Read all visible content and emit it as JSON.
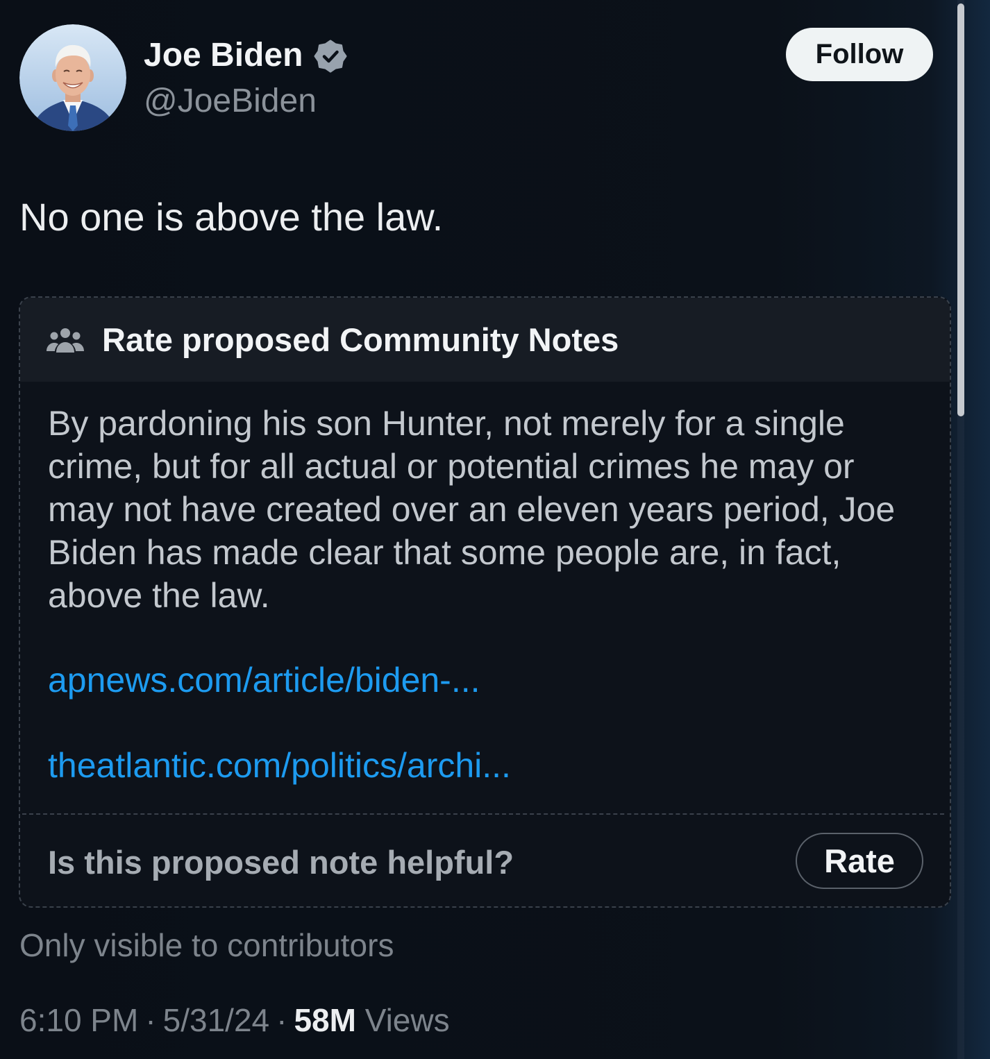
{
  "tweet": {
    "author": {
      "name": "Joe Biden",
      "handle": "@JoeBiden",
      "badge_icon": "verified-badge-icon",
      "avatar_icon": "profile-photo"
    },
    "follow_label": "Follow",
    "text": "No one is above the law.",
    "timestamp": {
      "time": "6:10 PM",
      "separator": "·",
      "date": "5/31/24",
      "views_count": "58M",
      "views_label": "Views"
    }
  },
  "community_note": {
    "header_icon": "community-icon",
    "header": "Rate proposed Community Notes",
    "body_lines": [
      "By pardoning his son Hunter, not merely for a single",
      "crime, but for all actual or potential crimes he may or",
      "may not have created over an eleven years period, Joe",
      "Biden has made clear that some people are, in fact,",
      "above the law."
    ],
    "links": [
      "apnews.com/article/biden-...",
      "theatlantic.com/politics/archi..."
    ],
    "helpful_prompt": "Is this proposed note helpful?",
    "rate_label": "Rate",
    "visibility": "Only visible to contributors"
  },
  "colors": {
    "background": "#0b1018",
    "link": "#1d9bf0",
    "follow_button": "#eff3f4",
    "badge": "#98a2ad"
  }
}
